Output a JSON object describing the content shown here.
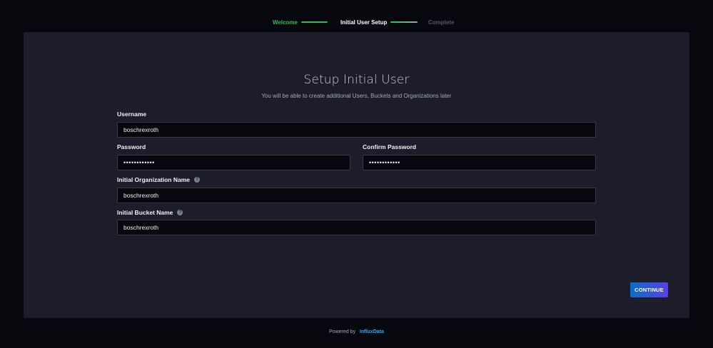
{
  "stepper": {
    "steps": [
      {
        "label": "Welcome",
        "state": "done"
      },
      {
        "label": "Initial User Setup",
        "state": "current"
      },
      {
        "label": "Complete",
        "state": "pending"
      }
    ]
  },
  "form": {
    "title": "Setup Initial User",
    "subtitle": "You will be able to create additional Users, Buckets and Organizations later",
    "username": {
      "label": "Username",
      "value": "boschrexroth"
    },
    "password": {
      "label": "Password",
      "value": "••••••••••••"
    },
    "confirm_password": {
      "label": "Confirm Password",
      "value": "••••••••••••"
    },
    "org_name": {
      "label": "Initial Organization Name",
      "value": "boschrexroth",
      "help_icon": "question-circle-icon"
    },
    "bucket_name": {
      "label": "Initial Bucket Name",
      "value": "boschrexroth",
      "help_icon": "question-circle-icon"
    },
    "continue_label": "CONTINUE"
  },
  "footer": {
    "powered_by": "Powered by",
    "brand": "InfluxData"
  },
  "colors": {
    "accent_green": "#34bb55",
    "button_gradient_start": "#066fc5",
    "button_gradient_end": "#5b3fe8",
    "brand_blue": "#22adf6"
  }
}
